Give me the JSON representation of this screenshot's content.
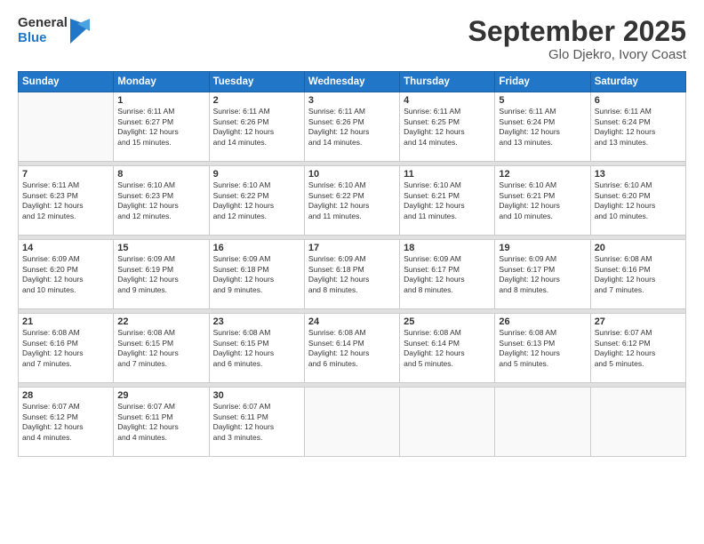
{
  "logo": {
    "general": "General",
    "blue": "Blue"
  },
  "header": {
    "month": "September 2025",
    "location": "Glo Djekro, Ivory Coast"
  },
  "weekdays": [
    "Sunday",
    "Monday",
    "Tuesday",
    "Wednesday",
    "Thursday",
    "Friday",
    "Saturday"
  ],
  "weeks": [
    [
      {
        "day": "",
        "info": ""
      },
      {
        "day": "1",
        "info": "Sunrise: 6:11 AM\nSunset: 6:27 PM\nDaylight: 12 hours\nand 15 minutes."
      },
      {
        "day": "2",
        "info": "Sunrise: 6:11 AM\nSunset: 6:26 PM\nDaylight: 12 hours\nand 14 minutes."
      },
      {
        "day": "3",
        "info": "Sunrise: 6:11 AM\nSunset: 6:26 PM\nDaylight: 12 hours\nand 14 minutes."
      },
      {
        "day": "4",
        "info": "Sunrise: 6:11 AM\nSunset: 6:25 PM\nDaylight: 12 hours\nand 14 minutes."
      },
      {
        "day": "5",
        "info": "Sunrise: 6:11 AM\nSunset: 6:24 PM\nDaylight: 12 hours\nand 13 minutes."
      },
      {
        "day": "6",
        "info": "Sunrise: 6:11 AM\nSunset: 6:24 PM\nDaylight: 12 hours\nand 13 minutes."
      }
    ],
    [
      {
        "day": "7",
        "info": "Sunrise: 6:11 AM\nSunset: 6:23 PM\nDaylight: 12 hours\nand 12 minutes."
      },
      {
        "day": "8",
        "info": "Sunrise: 6:10 AM\nSunset: 6:23 PM\nDaylight: 12 hours\nand 12 minutes."
      },
      {
        "day": "9",
        "info": "Sunrise: 6:10 AM\nSunset: 6:22 PM\nDaylight: 12 hours\nand 12 minutes."
      },
      {
        "day": "10",
        "info": "Sunrise: 6:10 AM\nSunset: 6:22 PM\nDaylight: 12 hours\nand 11 minutes."
      },
      {
        "day": "11",
        "info": "Sunrise: 6:10 AM\nSunset: 6:21 PM\nDaylight: 12 hours\nand 11 minutes."
      },
      {
        "day": "12",
        "info": "Sunrise: 6:10 AM\nSunset: 6:21 PM\nDaylight: 12 hours\nand 10 minutes."
      },
      {
        "day": "13",
        "info": "Sunrise: 6:10 AM\nSunset: 6:20 PM\nDaylight: 12 hours\nand 10 minutes."
      }
    ],
    [
      {
        "day": "14",
        "info": "Sunrise: 6:09 AM\nSunset: 6:20 PM\nDaylight: 12 hours\nand 10 minutes."
      },
      {
        "day": "15",
        "info": "Sunrise: 6:09 AM\nSunset: 6:19 PM\nDaylight: 12 hours\nand 9 minutes."
      },
      {
        "day": "16",
        "info": "Sunrise: 6:09 AM\nSunset: 6:18 PM\nDaylight: 12 hours\nand 9 minutes."
      },
      {
        "day": "17",
        "info": "Sunrise: 6:09 AM\nSunset: 6:18 PM\nDaylight: 12 hours\nand 8 minutes."
      },
      {
        "day": "18",
        "info": "Sunrise: 6:09 AM\nSunset: 6:17 PM\nDaylight: 12 hours\nand 8 minutes."
      },
      {
        "day": "19",
        "info": "Sunrise: 6:09 AM\nSunset: 6:17 PM\nDaylight: 12 hours\nand 8 minutes."
      },
      {
        "day": "20",
        "info": "Sunrise: 6:08 AM\nSunset: 6:16 PM\nDaylight: 12 hours\nand 7 minutes."
      }
    ],
    [
      {
        "day": "21",
        "info": "Sunrise: 6:08 AM\nSunset: 6:16 PM\nDaylight: 12 hours\nand 7 minutes."
      },
      {
        "day": "22",
        "info": "Sunrise: 6:08 AM\nSunset: 6:15 PM\nDaylight: 12 hours\nand 7 minutes."
      },
      {
        "day": "23",
        "info": "Sunrise: 6:08 AM\nSunset: 6:15 PM\nDaylight: 12 hours\nand 6 minutes."
      },
      {
        "day": "24",
        "info": "Sunrise: 6:08 AM\nSunset: 6:14 PM\nDaylight: 12 hours\nand 6 minutes."
      },
      {
        "day": "25",
        "info": "Sunrise: 6:08 AM\nSunset: 6:14 PM\nDaylight: 12 hours\nand 5 minutes."
      },
      {
        "day": "26",
        "info": "Sunrise: 6:08 AM\nSunset: 6:13 PM\nDaylight: 12 hours\nand 5 minutes."
      },
      {
        "day": "27",
        "info": "Sunrise: 6:07 AM\nSunset: 6:12 PM\nDaylight: 12 hours\nand 5 minutes."
      }
    ],
    [
      {
        "day": "28",
        "info": "Sunrise: 6:07 AM\nSunset: 6:12 PM\nDaylight: 12 hours\nand 4 minutes."
      },
      {
        "day": "29",
        "info": "Sunrise: 6:07 AM\nSunset: 6:11 PM\nDaylight: 12 hours\nand 4 minutes."
      },
      {
        "day": "30",
        "info": "Sunrise: 6:07 AM\nSunset: 6:11 PM\nDaylight: 12 hours\nand 3 minutes."
      },
      {
        "day": "",
        "info": ""
      },
      {
        "day": "",
        "info": ""
      },
      {
        "day": "",
        "info": ""
      },
      {
        "day": "",
        "info": ""
      }
    ]
  ]
}
